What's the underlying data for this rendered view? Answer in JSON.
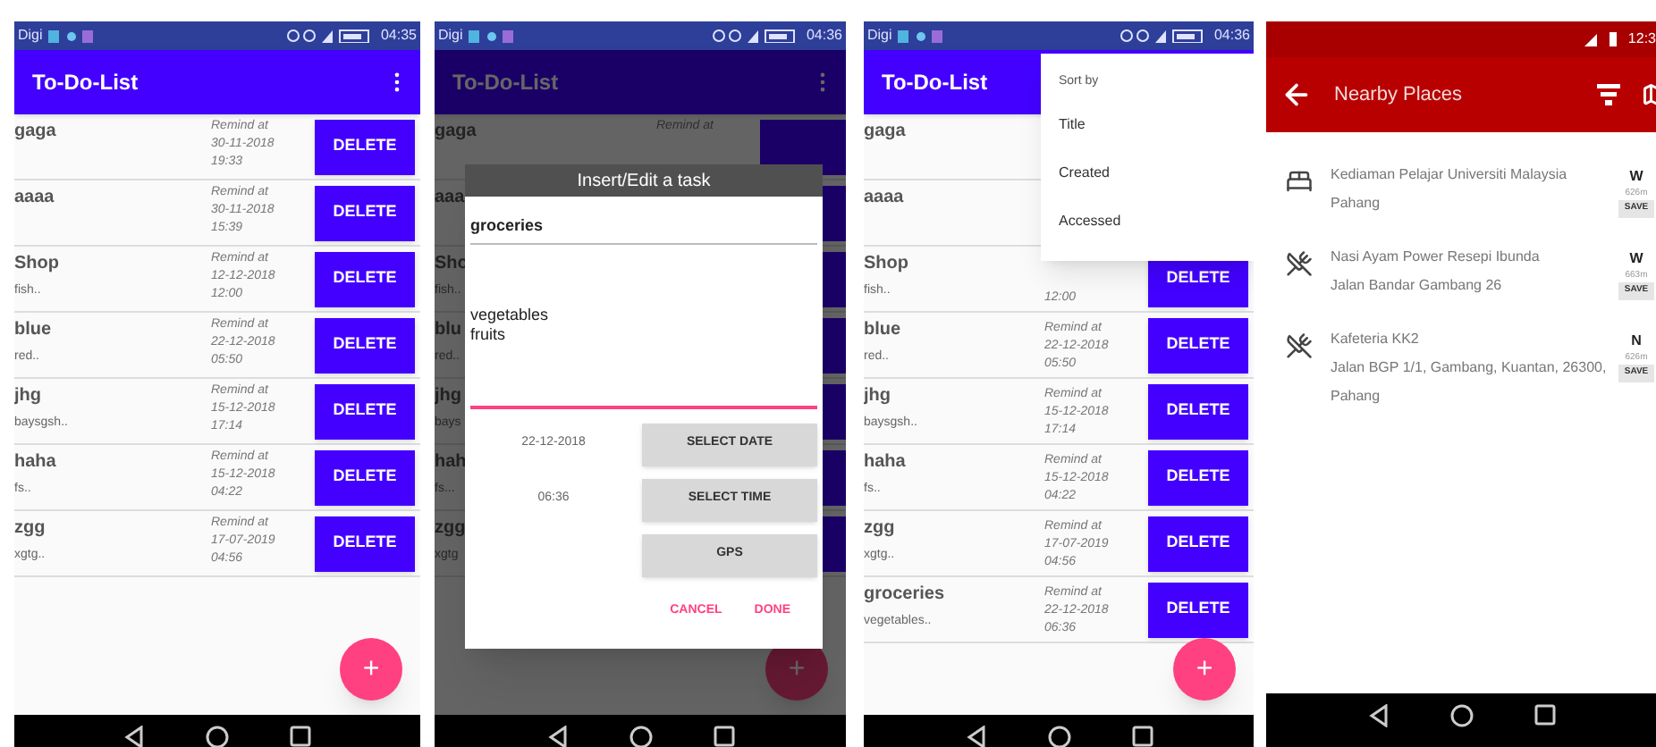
{
  "screens": [
    {
      "kind": "list",
      "status": {
        "carrier": "Digi",
        "time": "04:35"
      },
      "title": "To-Do-List",
      "tasks": [
        {
          "title": "gaga",
          "remind": [
            "Remind at",
            "30-11-2018",
            "19:33"
          ],
          "action": "DELETE"
        },
        {
          "title": "aaaa",
          "remind": [
            "Remind at",
            "30-11-2018",
            "15:39"
          ],
          "action": "DELETE"
        },
        {
          "title": "Shop",
          "note": "fish..",
          "remind": [
            "Remind at",
            "12-12-2018",
            "12:00"
          ],
          "action": "DELETE"
        },
        {
          "title": "blue",
          "note": "red..",
          "remind": [
            "Remind at",
            "22-12-2018",
            "05:50"
          ],
          "action": "DELETE"
        },
        {
          "title": "jhg",
          "note": "baysgsh..",
          "remind": [
            "Remind at",
            "15-12-2018",
            "17:14"
          ],
          "action": "DELETE"
        },
        {
          "title": "haha",
          "note": "fs..",
          "remind": [
            "Remind at",
            "15-12-2018",
            "04:22"
          ],
          "action": "DELETE"
        },
        {
          "title": "zgg",
          "note": "xgtg..",
          "remind": [
            "Remind at",
            "17-07-2019",
            "04:56"
          ],
          "action": "DELETE"
        }
      ],
      "fab": "+"
    },
    {
      "kind": "dialog",
      "status": {
        "carrier": "Digi",
        "time": "04:36"
      },
      "title": "To-Do-List",
      "tasks": [
        {
          "title": "gaga",
          "remind": [
            "Remind at"
          ]
        },
        {
          "title": "aaa"
        },
        {
          "title": "Sho",
          "note": "fish.."
        },
        {
          "title": "blu",
          "note": "red.."
        },
        {
          "title": "jhg",
          "note": "bays"
        },
        {
          "title": "hah",
          "note": "fs..."
        },
        {
          "title": "zgg",
          "note": "xgtg"
        }
      ],
      "fab": "+",
      "dialog": {
        "title": "Insert/Edit a task",
        "name": "groceries",
        "body": "vegetables\nfruits",
        "date": "22-12-2018",
        "time": "06:36",
        "buttons": [
          "SELECT DATE",
          "SELECT TIME",
          "GPS"
        ],
        "actions": [
          "CANCEL",
          "DONE"
        ]
      }
    },
    {
      "kind": "menu",
      "status": {
        "carrier": "Digi",
        "time": "04:36"
      },
      "title": "To-Do-List",
      "tasks": [
        {
          "title": "gaga"
        },
        {
          "title": "aaaa"
        },
        {
          "title": "Shop",
          "note": "fish..",
          "remind": [
            "12:00"
          ],
          "action": "DELETE"
        },
        {
          "title": "blue",
          "note": "red..",
          "remind": [
            "Remind at",
            "22-12-2018",
            "05:50"
          ],
          "action": "DELETE"
        },
        {
          "title": "jhg",
          "note": "baysgsh..",
          "remind": [
            "Remind at",
            "15-12-2018",
            "17:14"
          ],
          "action": "DELETE"
        },
        {
          "title": "haha",
          "note": "fs..",
          "remind": [
            "Remind at",
            "15-12-2018",
            "04:22"
          ],
          "action": "DELETE"
        },
        {
          "title": "zgg",
          "note": "xgtg..",
          "remind": [
            "Remind at",
            "17-07-2019",
            "04:56"
          ],
          "action": "DELETE"
        },
        {
          "title": "groceries",
          "note": "vegetables..",
          "remind": [
            "Remind at",
            "22-12-2018",
            "06:36"
          ],
          "action": "DELETE"
        }
      ],
      "fab": "+",
      "menu": {
        "header": "Sort by",
        "items": [
          "Title",
          "Created",
          "Accessed"
        ]
      }
    },
    {
      "kind": "places",
      "status": {
        "time": "12:3"
      },
      "title": "Nearby Places",
      "places": [
        {
          "kind": "lodging",
          "lines": [
            "Kediaman Pelajar Universiti Malaysia Pahang"
          ],
          "direction": "W",
          "distance": "626m",
          "action": "SAVE"
        },
        {
          "kind": "restaurant",
          "lines": [
            "Nasi Ayam Power Resepi Ibunda",
            "Jalan Bandar Gambang 26"
          ],
          "direction": "W",
          "distance": "663m",
          "action": "SAVE"
        },
        {
          "kind": "restaurant",
          "lines": [
            "Kafeteria KK2",
            "Jalan BGP 1/1, Gambang, Kuantan, 26300, Pahang"
          ],
          "direction": "N",
          "distance": "626m",
          "action": "SAVE"
        }
      ]
    }
  ]
}
